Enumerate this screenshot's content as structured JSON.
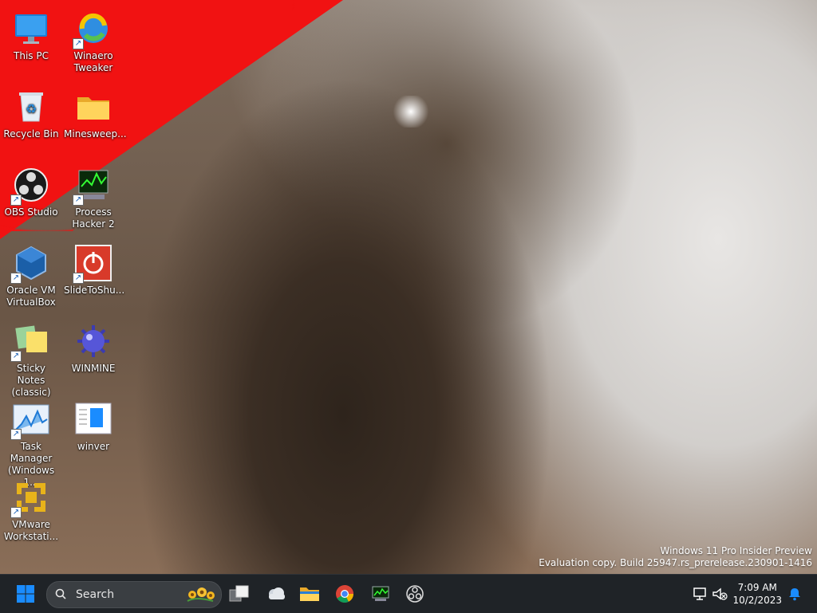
{
  "desktop": {
    "icons": [
      {
        "label": "This PC"
      },
      {
        "label": "Winaero Tweaker"
      },
      {
        "label": "Recycle Bin"
      },
      {
        "label": "Minesweep..."
      },
      {
        "label": "OBS Studio"
      },
      {
        "label": "Process Hacker 2"
      },
      {
        "label": "Oracle VM VirtualBox"
      },
      {
        "label": "SlideToShu..."
      },
      {
        "label": "Sticky Notes (classic)"
      },
      {
        "label": "WINMINE"
      },
      {
        "label": "Task Manager (Windows 1..."
      },
      {
        "label": "winver"
      },
      {
        "label": "VMware Workstati..."
      }
    ]
  },
  "watermark": {
    "line1": "Windows 11 Pro Insider Preview",
    "line2": "Evaluation copy. Build 25947.rs_prerelease.230901-1416"
  },
  "taskbar": {
    "search_placeholder": "Search",
    "time": "7:09 AM",
    "date": "10/2/2023",
    "accent_color": "#1a8cff"
  }
}
